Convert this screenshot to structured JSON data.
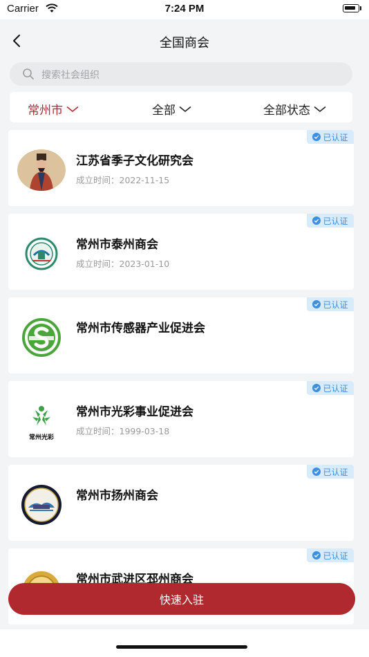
{
  "status_bar": {
    "carrier": "Carrier",
    "time": "7:24 PM"
  },
  "header": {
    "title": "全国商会"
  },
  "search": {
    "placeholder": "搜索社会组织"
  },
  "filters": [
    {
      "label": "常州市",
      "active": true
    },
    {
      "label": "全部",
      "active": false
    },
    {
      "label": "全部状态",
      "active": false
    }
  ],
  "organizations": [
    {
      "name": "江苏省季子文化研究会",
      "date": "成立时间：2022-11-15",
      "badge": "已认证",
      "logo": "portrait-logo"
    },
    {
      "name": "常州市泰州商会",
      "date": "成立时间：2023-01-10",
      "badge": "已认证",
      "logo": "emblem-logo"
    },
    {
      "name": "常州市传感器产业促进会",
      "date": "",
      "badge": "已认证",
      "logo": "s-association-logo"
    },
    {
      "name": "常州市光彩事业促进会",
      "date": "成立时间：1999-03-18",
      "badge": "已认证",
      "logo": "guangcai-logo",
      "logo_text": "常州光彩"
    },
    {
      "name": "常州市扬州商会",
      "date": "",
      "badge": "已认证",
      "logo": "circular-seal-logo"
    },
    {
      "name": "常州市武进区邳州商会",
      "date": "",
      "badge": "已认证",
      "logo": "gold-seal-logo"
    }
  ],
  "cta": {
    "label": "快速入驻"
  },
  "colors": {
    "accent": "#b0292f",
    "badge_bg": "#d8ebfb",
    "badge_text": "#3d8fe0"
  }
}
